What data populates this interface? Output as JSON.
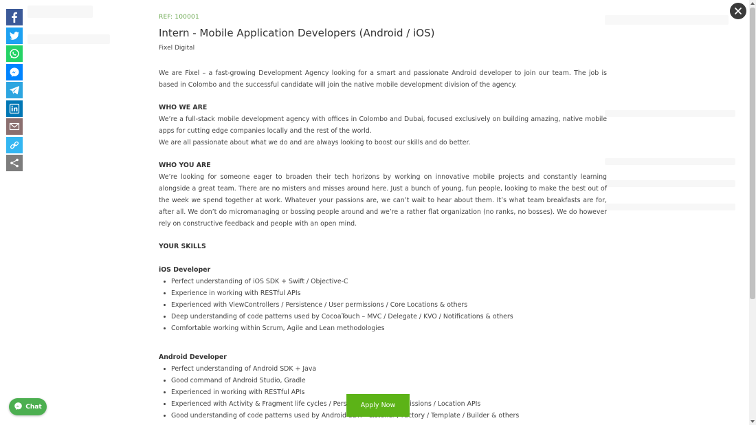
{
  "job": {
    "ref": "REF: 100001",
    "title": "Intern - Mobile Application Developers (Android / iOS)",
    "company": "Fixel Digital",
    "intro": "We are Fixel – a fast-growing Development Agency looking for a smart and passionate Android developer to join our team. The job is based in Colombo and the successful candidate will join the native mobile development division of the agency.",
    "who_we_are_heading": "WHO WE ARE",
    "who_we_are_p1": "We’re a full-stack mobile development agency with offices in Colombo and Dubai, focused exclusively on building amazing, native mobile apps for cutting edge companies locally and the rest of the world.",
    "who_we_are_p2": "We are all passionate about what we do and are always looking to boost our skills and do better.",
    "who_you_are_heading": "WHO YOU ARE",
    "who_you_are_p": "We’re looking for someone eager to broaden their tech horizons by working on innovative mobile projects and constantly learning alongside a great team. There are no misters and misses around here. Just a bunch of young, fun people, looking to make the best out of the week we spend together at work. Whatever your passions are, we can’t wait to hear about them. It’s what team breakfasts are for, after all. We don’t do micromanaging or bossing people around and we’re a rather flat organization (no ranks, no bosses). We do however rely on constructive feedback and people with an open mind.",
    "your_skills_heading": "YOUR SKILLS",
    "ios_heading": "iOS Developer",
    "ios_skills": [
      "Perfect understanding of iOS SDK + Swift / Objective-C",
      "Experience in working with RESTful APIs",
      "Experienced with ViewControllers / Persistence / User permissions / Core Locations & others",
      "Deep understanding of code patterns used by CocoaTouch – MVC / Delegate / KVO / Notifications & others",
      "Comfortable working within Scrum, Agile and Lean methodologies"
    ],
    "android_heading": "Android Developer",
    "android_skills": [
      "Perfect understanding of Android SDK + Java",
      "Good command of Android Studio, Gradle",
      "Experienced in working with RESTful APIs",
      "Experienced with Activity & Fragment life cycles / Persistence / User permissions / Location APIs",
      "Good understanding of code patterns used by Android SDK – Listener / Factory / Template / Builder & others"
    ]
  },
  "actions": {
    "apply_label": "Apply Now",
    "chat_label": "Chat"
  },
  "share": {
    "items": [
      {
        "name": "facebook-share-button",
        "icon": "facebook-icon",
        "color": "#3b5998"
      },
      {
        "name": "twitter-share-button",
        "icon": "twitter-icon",
        "color": "#1da1f2"
      },
      {
        "name": "whatsapp-share-button",
        "icon": "whatsapp-icon",
        "color": "#25d366"
      },
      {
        "name": "messenger-share-button",
        "icon": "messenger-icon",
        "color": "#0084ff"
      },
      {
        "name": "telegram-share-button",
        "icon": "telegram-icon",
        "color": "#2ca5e0"
      },
      {
        "name": "linkedin-share-button",
        "icon": "linkedin-icon",
        "color": "#0077b5"
      },
      {
        "name": "email-share-button",
        "icon": "email-icon",
        "color": "#8b6f6f"
      },
      {
        "name": "copy-link-button",
        "icon": "link-icon",
        "color": "#33b6f2"
      },
      {
        "name": "more-share-button",
        "icon": "share-icon",
        "color": "#7d7d7d"
      }
    ]
  },
  "colors": {
    "accent_green": "#5cb317",
    "ref_green": "#6aa84f",
    "close_bg": "#3a3a3a"
  }
}
